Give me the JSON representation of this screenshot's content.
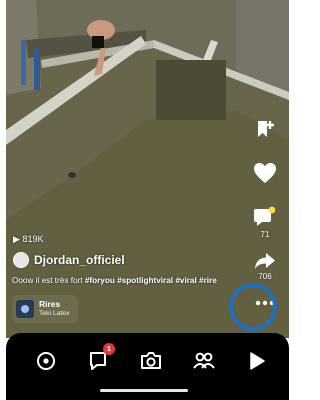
{
  "post": {
    "views": "819K",
    "username": "Djordan_officiel",
    "caption_text": "Ooow il est très fort ",
    "caption_hashtags": "#foryou #spotlightviral #viral #rire"
  },
  "sound": {
    "title": "Rires",
    "artist": "Teki Latex"
  },
  "actions": {
    "comments_count": "71",
    "shares_count": "706"
  },
  "nav": {
    "chat_badge": "1"
  },
  "colors": {
    "highlight_ring": "#1f6fc3",
    "badge": "#e8353e",
    "story_dot": "#ffd93b"
  }
}
